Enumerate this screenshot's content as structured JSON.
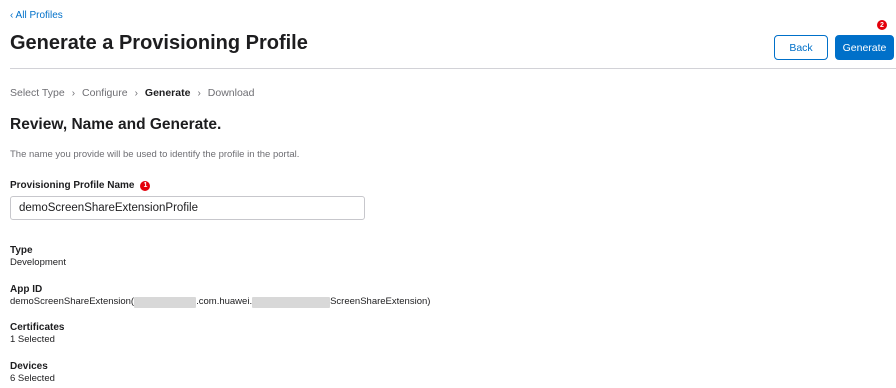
{
  "nav": {
    "back_link": "‹ All Profiles"
  },
  "header": {
    "title": "Generate a Provisioning Profile",
    "back_label": "Back",
    "generate_label": "Generate",
    "generate_badge": "2"
  },
  "steps": [
    {
      "label": "Select Type",
      "active": false
    },
    {
      "label": "Configure",
      "active": false
    },
    {
      "label": "Generate",
      "active": true
    },
    {
      "label": "Download",
      "active": false
    }
  ],
  "steps_separator": "›",
  "section": {
    "title": "Review, Name and Generate.",
    "description": "The name you provide will be used to identify the profile in the portal."
  },
  "profile_name": {
    "label": "Provisioning Profile Name",
    "badge": "1",
    "value": "demoScreenShareExtensionProfile"
  },
  "details": {
    "type": {
      "label": "Type",
      "value": "Development"
    },
    "app_id": {
      "label": "App ID",
      "value_prefix": "demoScreenShareExtension(",
      "value_middle": ".com.huawei.",
      "value_suffix": "ScreenShareExtension)"
    },
    "certificates": {
      "label": "Certificates",
      "value": "1 Selected"
    },
    "devices": {
      "label": "Devices",
      "value": "6 Selected"
    }
  },
  "colors": {
    "accent": "#0070c9",
    "badge": "#e3000b"
  }
}
